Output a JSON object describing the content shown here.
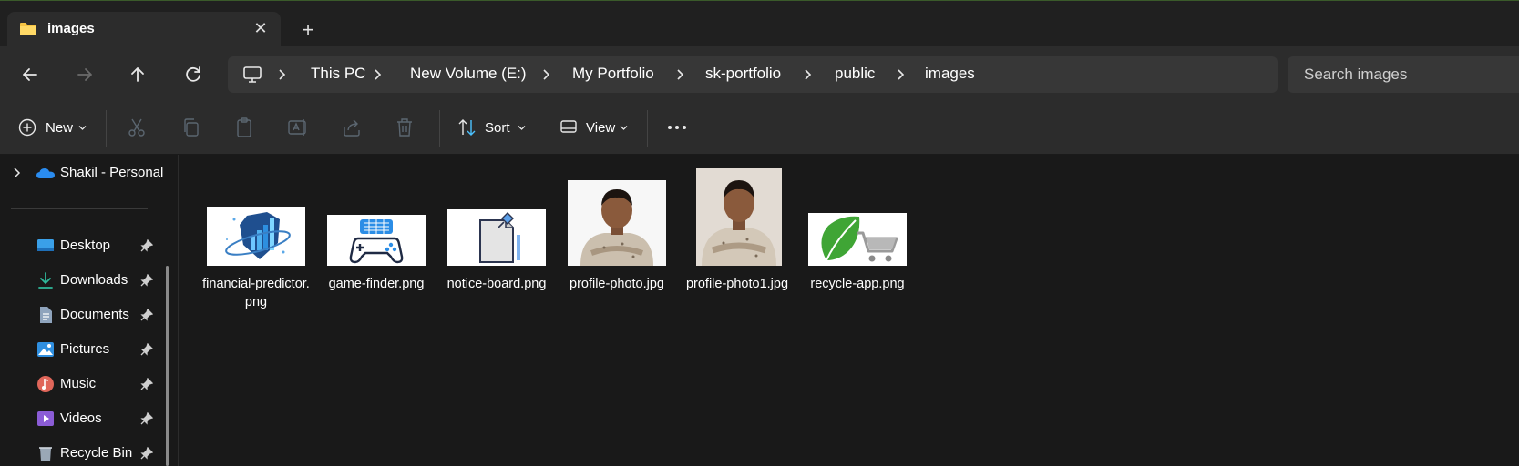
{
  "tab": {
    "title": "images",
    "close_icon": "close-icon",
    "new_tab_icon": "plus-icon"
  },
  "nav": {
    "back": "back-arrow-icon",
    "forward": "forward-arrow-icon",
    "up": "up-arrow-icon",
    "refresh": "refresh-icon"
  },
  "breadcrumb": [
    "This PC",
    "New Volume (E:)",
    "My Portfolio",
    "sk-portfolio",
    "public",
    "images"
  ],
  "search": {
    "placeholder": "Search images"
  },
  "toolbar": {
    "new_label": "New",
    "sort_label": "Sort",
    "view_label": "View"
  },
  "sidebar": {
    "onedrive": "Shakil - Personal",
    "items": [
      {
        "label": "Desktop",
        "icon": "desktop-icon"
      },
      {
        "label": "Downloads",
        "icon": "downloads-icon"
      },
      {
        "label": "Documents",
        "icon": "documents-icon"
      },
      {
        "label": "Pictures",
        "icon": "pictures-icon"
      },
      {
        "label": "Music",
        "icon": "music-icon"
      },
      {
        "label": "Videos",
        "icon": "videos-icon"
      },
      {
        "label": "Recycle Bin",
        "icon": "recycle-bin-icon"
      }
    ]
  },
  "files": [
    {
      "name": "financial-predictor.png"
    },
    {
      "name": "game-finder.png"
    },
    {
      "name": "notice-board.png"
    },
    {
      "name": "profile-photo.jpg"
    },
    {
      "name": "profile-photo1.jpg"
    },
    {
      "name": "recycle-app.png"
    }
  ],
  "colors": {
    "accent_blue": "#4cc2ff",
    "folder_yellow": "#f6c343",
    "leaf_green": "#3fa535"
  }
}
